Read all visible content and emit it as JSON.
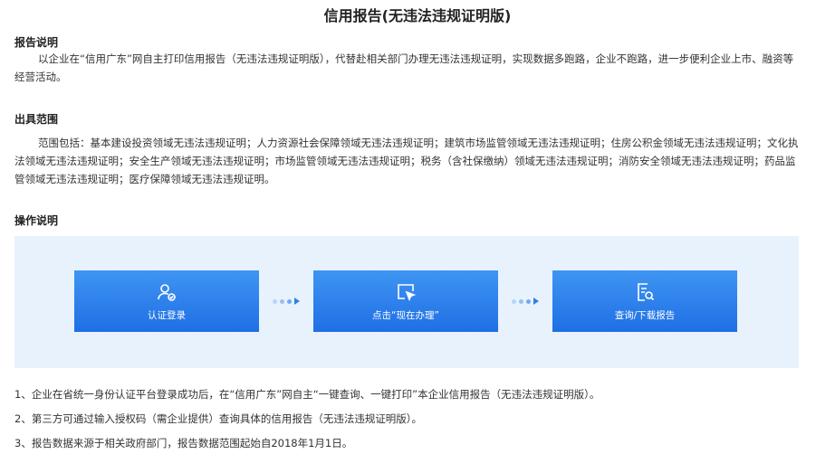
{
  "title": "信用报告(无违法违规证明版)",
  "report_desc": {
    "heading": "报告说明",
    "text": "以企业在“信用广东”网自主打印信用报告（无违法违规证明版），代替赴相关部门办理无违法违规证明，实现数据多跑路，企业不跑路，进一步便利企业上市、融资等经营活动。"
  },
  "scope": {
    "heading": "出具范围",
    "text": "范围包括：基本建设投资领域无违法违规证明；人力资源社会保障领域无违法违规证明；建筑市场监管领域无违法违规证明；住房公积金领域无违法违规证明；文化执法领域无违法违规证明；安全生产领域无违法违规证明；市场监管领域无违法违规证明；税务（含社保缴纳）领域无违法违规证明；消防安全领域无违法违规证明；药品监管领域无违法违规证明；医疗保障领域无违法违规证明。"
  },
  "operation": {
    "heading": "操作说明",
    "steps": [
      {
        "label": "认证登录",
        "icon": "user-check-icon"
      },
      {
        "label": "点击“现在办理”",
        "icon": "cursor-click-icon"
      },
      {
        "label": "查询/下载报告",
        "icon": "document-search-icon"
      }
    ]
  },
  "notes": [
    "1、企业在省统一身份认证平台登录成功后，在“信用广东”网自主“一键查询、一键打印”本企业信用报告（无违法违规证明版）。",
    "2、第三方可通过输入授权码（需企业提供）查询具体的信用报告（无违法违规证明版）。",
    "3、报告数据来源于相关政府部门，报告数据范围起始自2018年1月1日。"
  ]
}
